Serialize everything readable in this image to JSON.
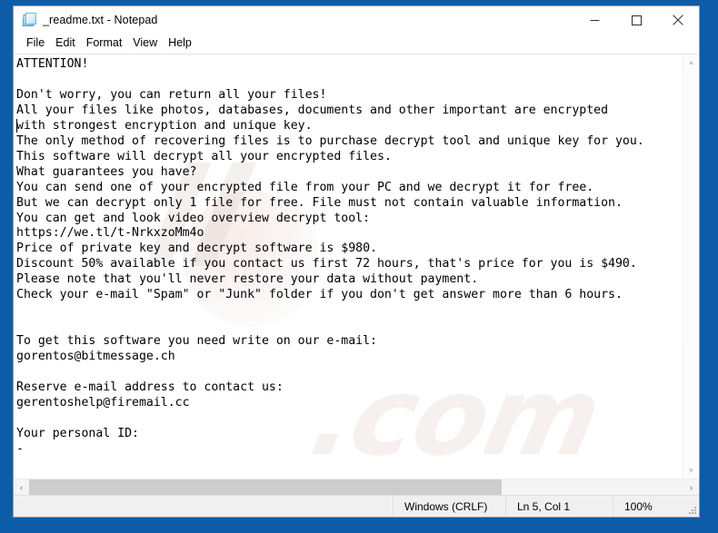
{
  "window": {
    "title": "_readme.txt - Notepad",
    "icon": "notepad-icon",
    "controls": {
      "minimize": "minimize-icon",
      "maximize": "maximize-icon",
      "close": "close-icon"
    }
  },
  "menu": {
    "items": [
      {
        "label": "File"
      },
      {
        "label": "Edit"
      },
      {
        "label": "Format"
      },
      {
        "label": "View"
      },
      {
        "label": "Help"
      }
    ]
  },
  "document": {
    "text": "ATTENTION!\n\nDon't worry, you can return all your files!\nAll your files like photos, databases, documents and other important are encrypted\nwith strongest encryption and unique key.\nThe only method of recovering files is to purchase decrypt tool and unique key for you.\nThis software will decrypt all your encrypted files.\nWhat guarantees you have?\nYou can send one of your encrypted file from your PC and we decrypt it for free.\nBut we can decrypt only 1 file for free. File must not contain valuable information.\nYou can get and look video overview decrypt tool:\nhttps://we.tl/t-NrkxzoMm4o\nPrice of private key and decrypt software is $980.\nDiscount 50% available if you contact us first 72 hours, that's price for you is $490.\nPlease note that you'll never restore your data without payment.\nCheck your e-mail \"Spam\" or \"Junk\" folder if you don't get answer more than 6 hours.\n\n\nTo get this software you need write on our e-mail:\ngorentos@bitmessage.ch\n\nReserve e-mail address to contact us:\ngerentoshelp@firemail.cc\n\nYour personal ID:\n-",
    "watermark_primary": "ll",
    "watermark_secondary": ".com"
  },
  "statusbar": {
    "line_ending": "Windows (CRLF)",
    "cursor_position": "Ln 5, Col 1",
    "zoom": "100%"
  },
  "scrollbars": {
    "vertical_up": "▲",
    "vertical_down": "▼",
    "horizontal_left": "‹",
    "horizontal_right": "›"
  }
}
